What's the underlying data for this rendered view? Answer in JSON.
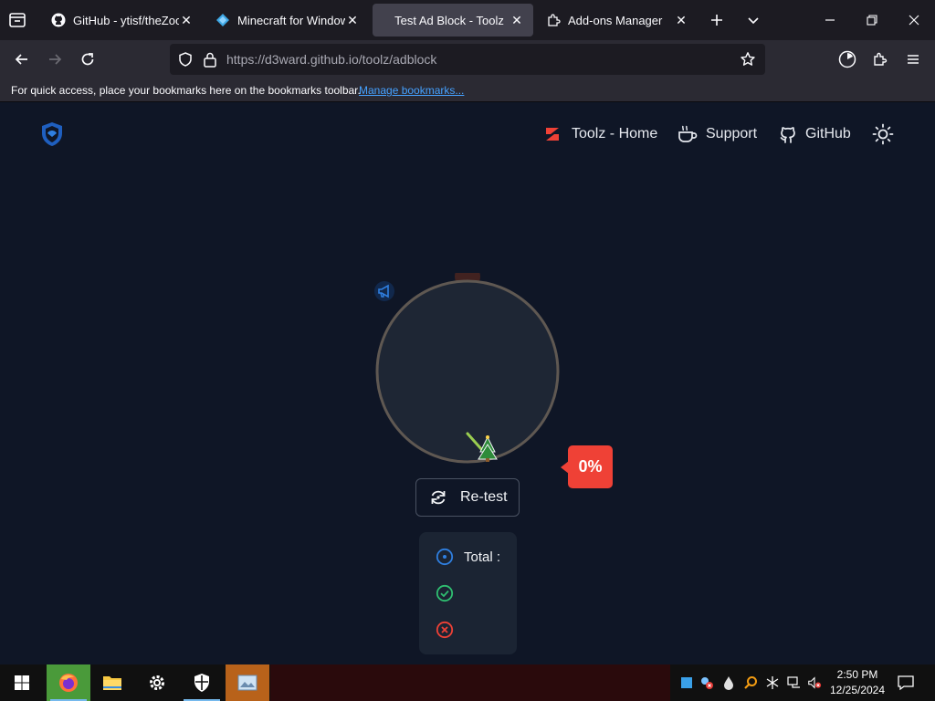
{
  "browser": {
    "tabs": [
      {
        "title": "GitHub - ytisf/theZoo:",
        "icon": "github-icon",
        "active": false
      },
      {
        "title": "Minecraft for Windows",
        "icon": "minecraft-icon",
        "active": false
      },
      {
        "title": "Test Ad Block - Toolz",
        "icon": "none",
        "active": true
      },
      {
        "title": "Add-ons Manager",
        "icon": "puzzle-icon",
        "active": false
      }
    ],
    "url_host": "https://d3ward.github.io",
    "url_path": "/toolz/adblock",
    "bookmarks_text": "For quick access, place your bookmarks here on the bookmarks toolbar.",
    "bookmarks_link": "Manage bookmarks..."
  },
  "page": {
    "nav": {
      "home": "Toolz - Home",
      "support": "Support",
      "github": "GitHub"
    },
    "progress_percent": 0,
    "badge": "0%",
    "retest": "Re-test",
    "stats": {
      "total_label": "Total :",
      "passed": "",
      "failed": ""
    }
  },
  "taskbar": {
    "time": "2:50 PM",
    "date": "12/25/2024",
    "apps": [
      "firefox-icon",
      "file-explorer-icon",
      "settings-icon",
      "windows-security-icon",
      "image-viewer-icon"
    ]
  },
  "colors": {
    "page_bg": "#0f1626",
    "accent_red": "#ef4136",
    "accent_blue": "#2f7fe0",
    "success_green": "#2fbf71"
  }
}
